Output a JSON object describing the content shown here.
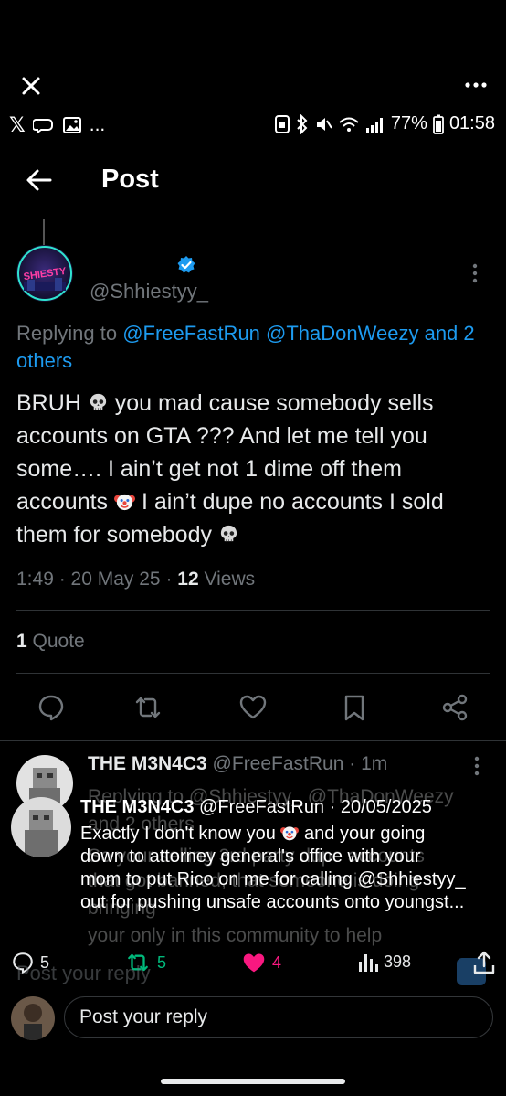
{
  "browser": {
    "close_icon": "close-icon",
    "more_icon": "more-horizontal-icon"
  },
  "status_bar": {
    "app_icons": [
      "x-logo-icon",
      "messages-icon",
      "gallery-icon"
    ],
    "app_logo_text": "𝕏",
    "ellipsis": "...",
    "battery": "77%",
    "time": "01:58"
  },
  "header": {
    "back_icon": "back-arrow-icon",
    "title": "Post"
  },
  "tweet": {
    "handle": "@Shhiestyy_",
    "avatar_text": "SHIESTY",
    "verified": true,
    "replying_prefix": "Replying to",
    "replying_mentions": "@FreeFastRun @ThaDonWeezy and 2 others",
    "text_parts": [
      "BRUH ",
      " you mad cause somebody sells accounts on GTA ??? And let me tell you some…. I ain’t get not 1 dime off them accounts ",
      " I ain’t dupe no accounts I sold them for somebody "
    ],
    "emojis": [
      "skull-emoji",
      "clown-emoji",
      "skull-emoji"
    ],
    "time": "1:49",
    "date": "20 May 25",
    "views_count": "12",
    "views_label": "Views",
    "quote_count": "1",
    "quote_label": "Quote",
    "actions": [
      "reply-icon",
      "repost-icon",
      "like-icon",
      "bookmark-icon",
      "share-icon"
    ]
  },
  "reply": {
    "name": "THE M3N4C3",
    "handle_time": "@FreeFastRun · 1m",
    "faded_line1": "Replying to @Shhiestyy_ @ThaDonWeezy",
    "faded_line2": "and 2 others",
    "faded_line3": "So your selling 3rd party dupe accounts",
    "faded_line4": "that got banned, that someone is doing",
    "faded_line5": "bringing  ",
    "faded_line6": "your only in this community to help"
  },
  "quoted_screenshot": {
    "name": "THE M3N4C3",
    "handle_date": "@FreeFastRun · 20/05/2025",
    "line1": "Exactly I don't know you ",
    "line1_end": " and your going",
    "line2": "down to attorney general's office with your",
    "line3": "mom to put Rico on me for calling @Shhiestyy_",
    "line4": "out for pushing unsafe accounts onto youngst..."
  },
  "engagement": {
    "replies": "5",
    "reposts": "5",
    "likes": "4",
    "views": "398"
  },
  "composer": {
    "faded_placeholder": "Post your reply",
    "placeholder": "Post your reply"
  },
  "colors": {
    "accent": "#1d9bf0",
    "repost_green": "#00ba7c",
    "like_pink": "#f91880",
    "muted": "#71767b"
  }
}
